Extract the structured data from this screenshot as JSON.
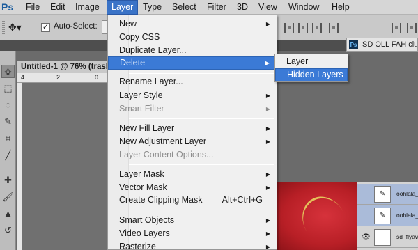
{
  "app": {
    "logo": "Ps"
  },
  "menubar": {
    "items": [
      "File",
      "Edit",
      "Image",
      "Layer",
      "Type",
      "Select",
      "Filter",
      "3D",
      "View",
      "Window",
      "Help"
    ],
    "active": "Layer"
  },
  "options": {
    "autoselect_label": "Auto-Select:",
    "check_mark": "✓"
  },
  "doc_tab": {
    "icon": "Ps",
    "title": "SD OLL FAH clu"
  },
  "document": {
    "title": "Untitled-1 @ 76% (trash",
    "ruler_labels": [
      "4",
      "2",
      "0"
    ]
  },
  "menu": {
    "items": {
      "new": "New",
      "copy_css": "Copy CSS",
      "duplicate": "Duplicate Layer...",
      "delete": "Delete",
      "rename": "Rename Layer...",
      "layer_style": "Layer Style",
      "smart_filter": "Smart Filter",
      "new_fill": "New Fill Layer",
      "new_adjustment": "New Adjustment Layer",
      "content_options": "Layer Content Options...",
      "layer_mask": "Layer Mask",
      "vector_mask": "Vector Mask",
      "clipping_mask": "Create Clipping Mask",
      "clipping_mask_shortcut": "Alt+Ctrl+G",
      "smart_objects": "Smart Objects",
      "video_layers": "Video Layers",
      "rasterize": "Rasterize"
    },
    "submenu_arrow": "▶"
  },
  "submenu": {
    "items": [
      "Layer",
      "Hidden Layers"
    ],
    "highlighted": "Hidden Layers"
  },
  "layers_panel": {
    "rows": [
      {
        "name": "oohlala_fl",
        "visible": false
      },
      {
        "name": "oohlala_fl",
        "visible": false
      },
      {
        "name": "sd_flyawa",
        "visible": true
      }
    ],
    "eye_icon": "👁"
  },
  "colors": {
    "menu_highlight": "#3b7ad6",
    "artwork_red": "#c0222b"
  }
}
